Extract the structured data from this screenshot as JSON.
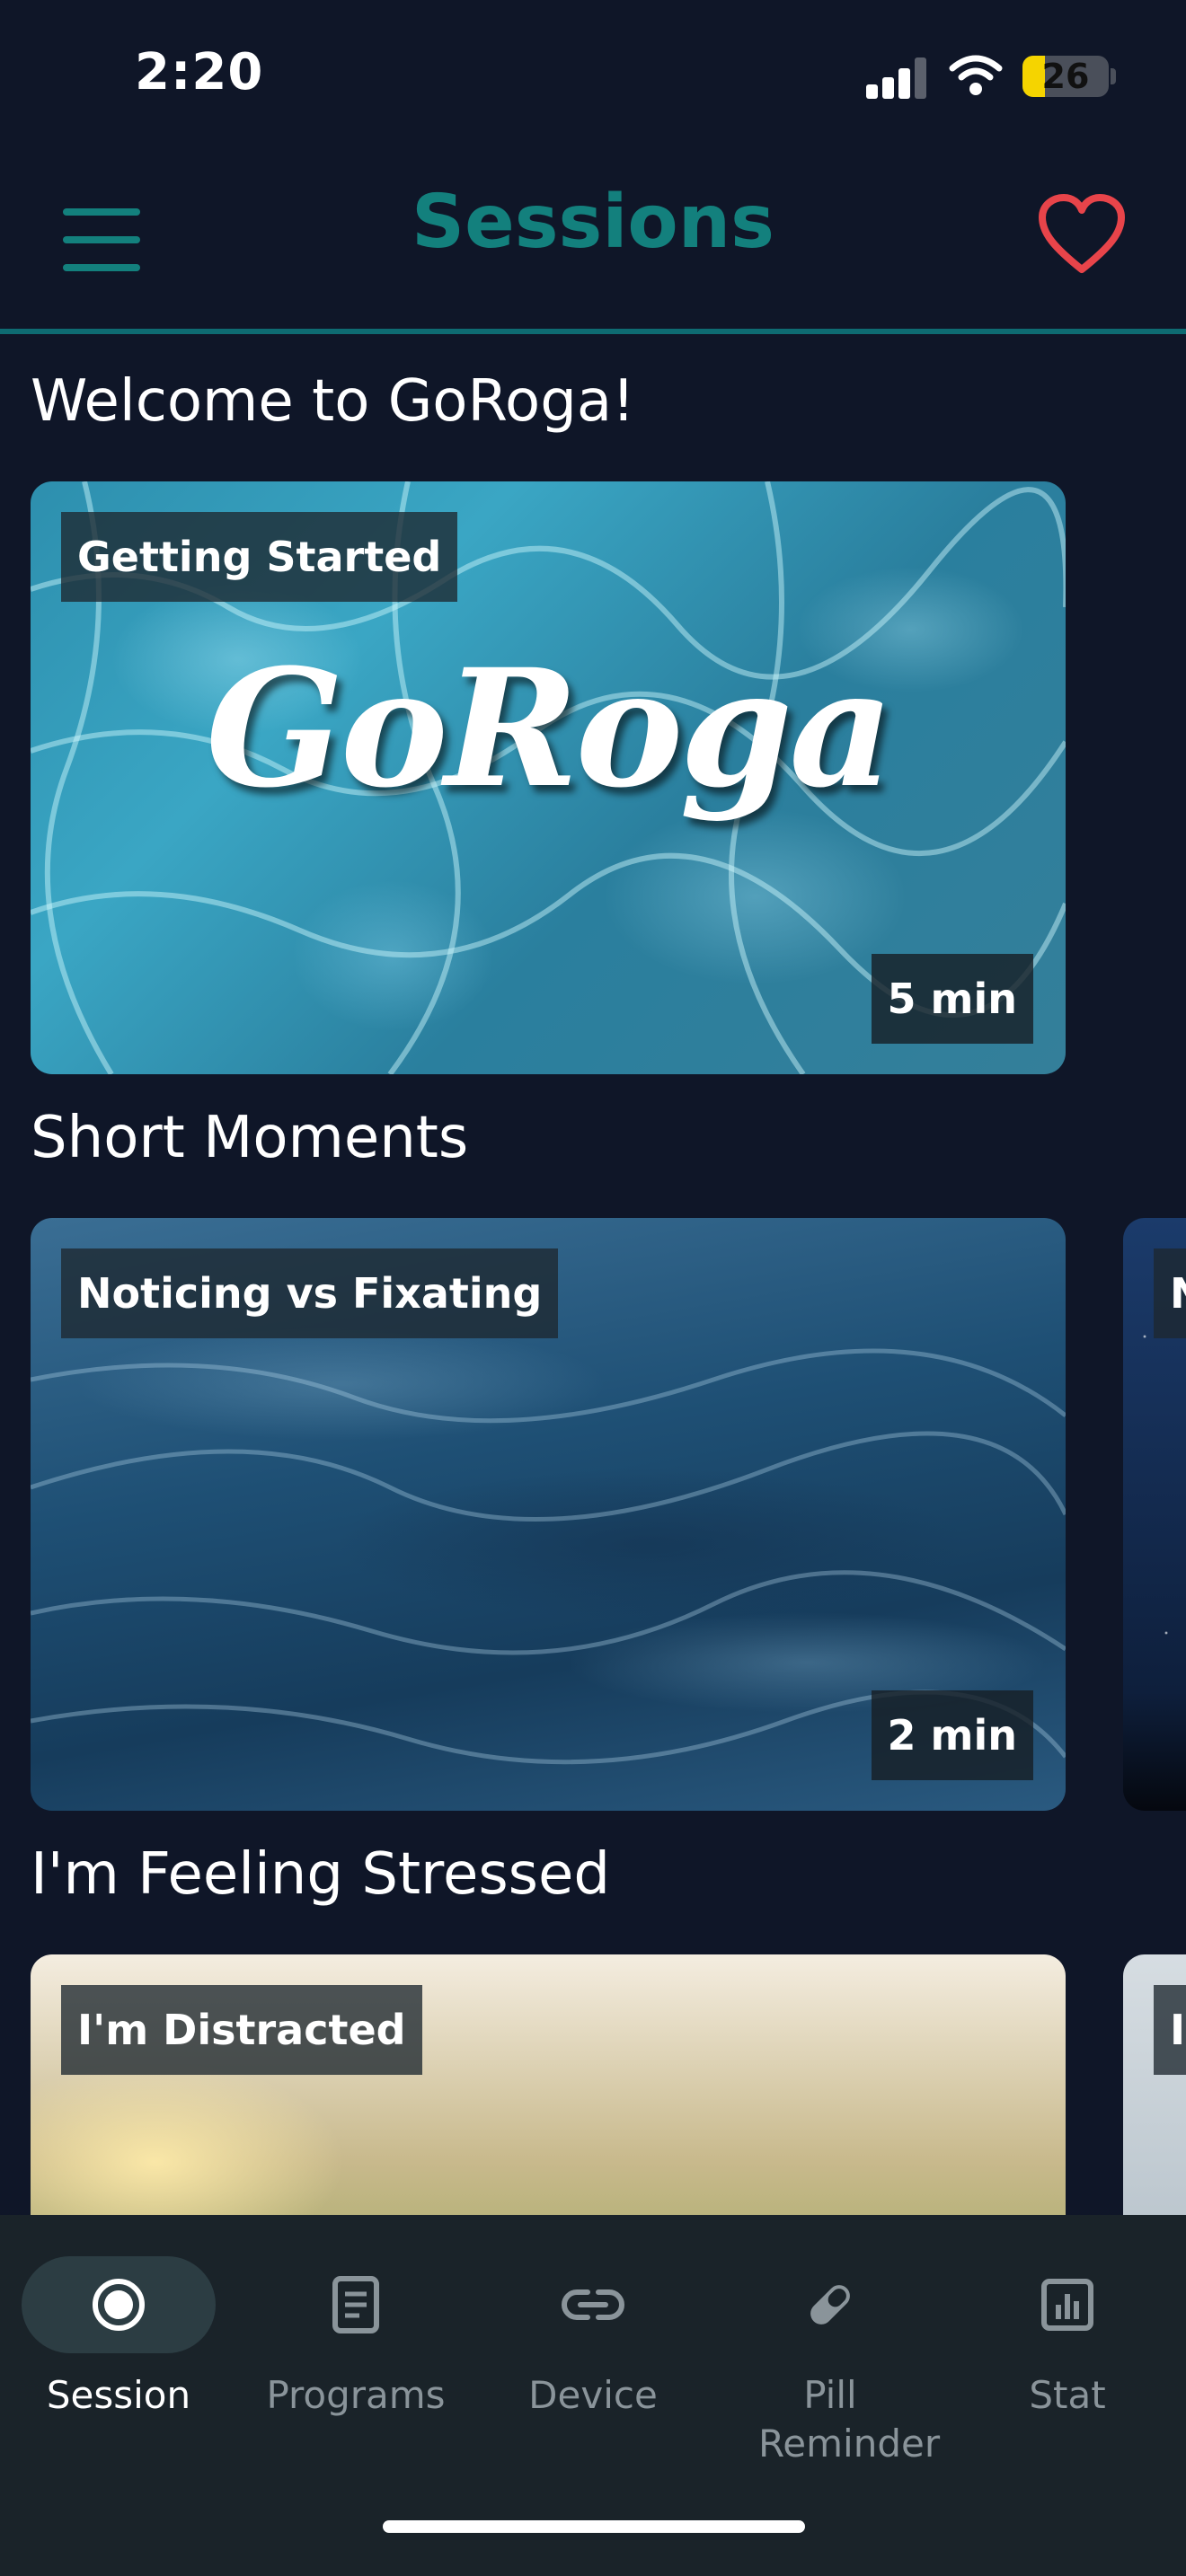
{
  "status_bar": {
    "time": "2:20",
    "battery_level": "26",
    "battery_fraction": 0.26
  },
  "header": {
    "title": "Sessions",
    "menu_icon": "hamburger-menu-icon",
    "favorites_icon": "heart-icon"
  },
  "sections": [
    {
      "title": "Welcome to GoRoga!",
      "cards": [
        {
          "tag": "Getting Started",
          "duration": "5 min",
          "logo_text": "GoRoga",
          "image": "water-ripples"
        }
      ]
    },
    {
      "title": "Short Moments",
      "cards": [
        {
          "tag": "Noticing vs Fixating",
          "duration": "2 min",
          "image": "ocean-wave"
        },
        {
          "tag": "N",
          "image": "starry-night"
        }
      ]
    },
    {
      "title": "I'm Feeling Stressed",
      "cards": [
        {
          "tag": "I'm Distracted",
          "image": "flower-meadow"
        },
        {
          "tag": "I",
          "image": "mountains"
        }
      ]
    }
  ],
  "bottom_nav": {
    "items": [
      {
        "label": "Session",
        "icon": "session-record-icon",
        "active": true
      },
      {
        "label": "Programs",
        "icon": "document-icon",
        "active": false
      },
      {
        "label": "Device",
        "icon": "link-icon",
        "active": false
      },
      {
        "label": "Pill Reminder",
        "icon": "pill-icon",
        "active": false
      },
      {
        "label": "Stat",
        "icon": "bar-chart-icon",
        "active": false
      }
    ]
  }
}
